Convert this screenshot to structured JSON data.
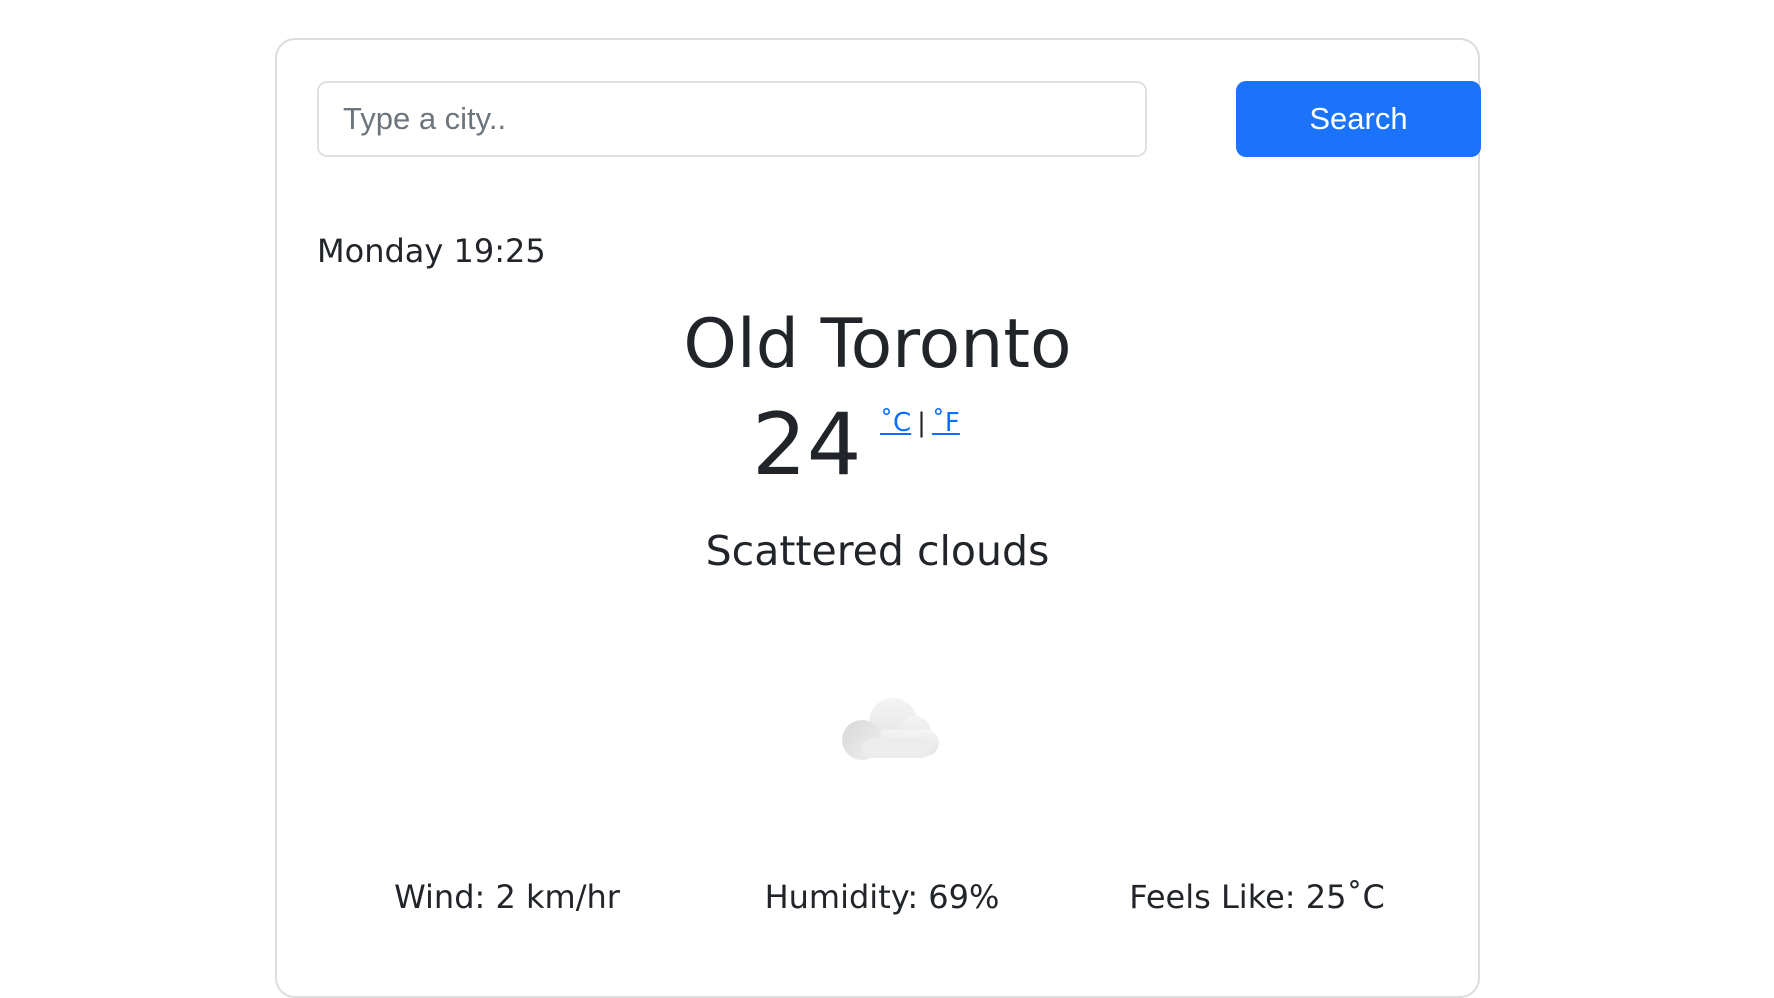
{
  "search": {
    "placeholder": "Type a city..",
    "value": "",
    "button_label": "Search"
  },
  "weather": {
    "datetime": "Monday 19:25",
    "city": "Old Toronto",
    "temperature": "24",
    "unit_celsius": "˚C",
    "unit_separator": "|",
    "unit_fahrenheit": "˚F",
    "description": "Scattered clouds",
    "icon": "cloud-icon"
  },
  "stats": {
    "wind": "Wind: 2 km/hr",
    "humidity": "Humidity: 69%",
    "feels_like": "Feels Like: 25˚C"
  },
  "colors": {
    "accent": "#1a73f8",
    "link": "#0d6efd",
    "text": "#212529",
    "border": "#dcdcdc"
  }
}
